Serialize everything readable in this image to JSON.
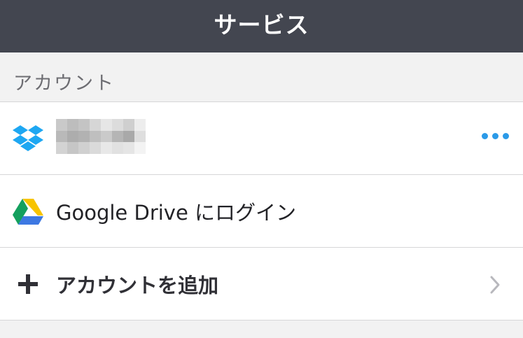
{
  "nav": {
    "title": "サービス"
  },
  "section": {
    "title": "アカウント"
  },
  "rows": [
    {
      "icon": "dropbox-icon",
      "label": "",
      "action_icon": "more-dots-icon"
    },
    {
      "icon": "google-drive-icon",
      "label": "Google Drive にログイン"
    },
    {
      "icon": "plus-icon",
      "label": "アカウントを追加",
      "action_icon": "chevron-right-icon"
    }
  ],
  "colors": {
    "navbar": "#434650",
    "accent": "#2b9ae8",
    "dropbox": "#1ea7f2",
    "background": "#f2f2f2"
  }
}
